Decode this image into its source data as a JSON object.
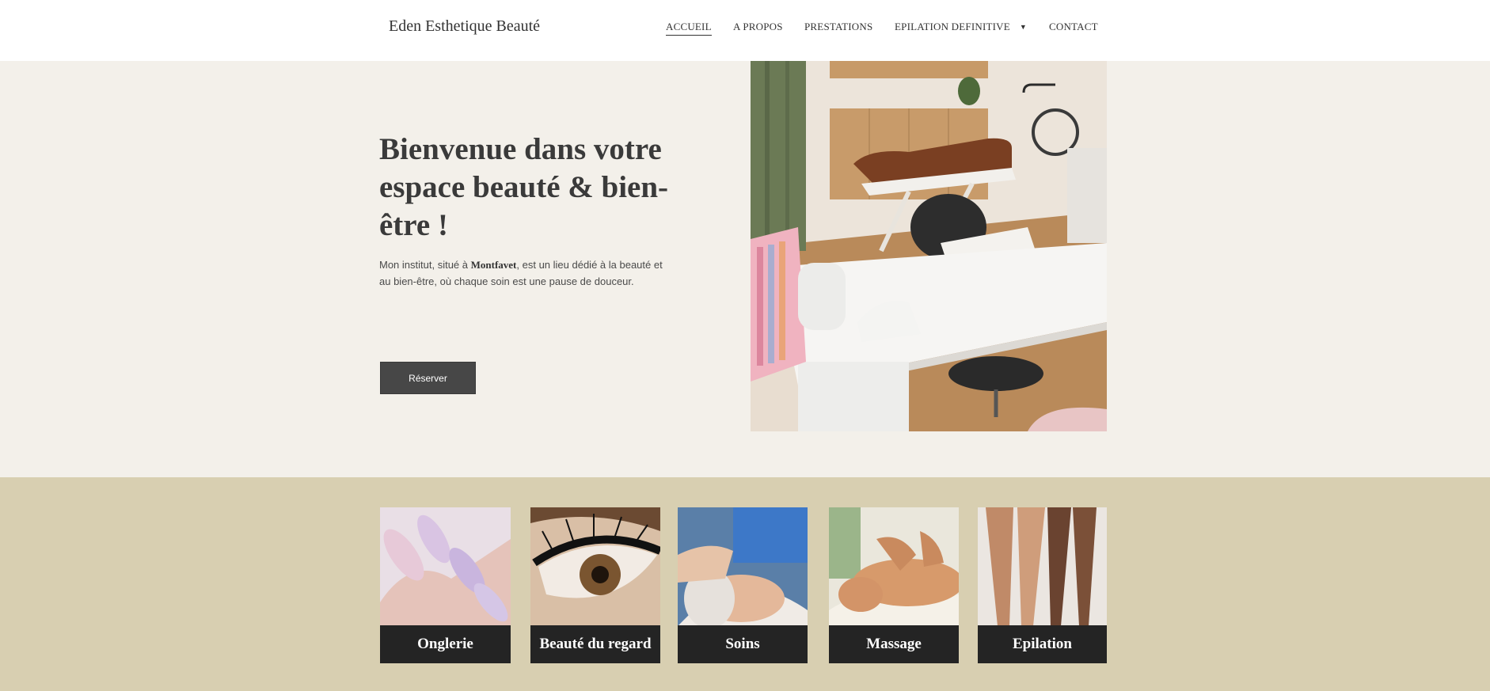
{
  "header": {
    "logo": "Eden Esthetique Beauté",
    "nav": [
      {
        "label": "ACCUEIL",
        "active": true
      },
      {
        "label": "A PROPOS"
      },
      {
        "label": "PRESTATIONS"
      },
      {
        "label": "EPILATION DEFINITIVE",
        "has_dropdown": true,
        "dropdown_icon": "caret-down-icon"
      },
      {
        "label": "CONTACT"
      }
    ]
  },
  "hero": {
    "title": "Bienvenue dans votre espace beauté & bien-être !",
    "text_before": "Mon institut, situé à ",
    "text_bold": "Montfavet",
    "text_after": ", est un lieu dédié à la beauté et au bien-être, où chaque soin est une pause de douceur.",
    "button": "Réserver"
  },
  "services": [
    {
      "label": "Onglerie"
    },
    {
      "label": "Beauté du regard"
    },
    {
      "label": "Soins"
    },
    {
      "label": "Massage"
    },
    {
      "label": "Epilation"
    }
  ],
  "colors": {
    "hero_bg": "#f3f0ea",
    "services_bg": "#d8cfb1",
    "card_label_bg": "#242424",
    "button_bg": "#474747"
  }
}
